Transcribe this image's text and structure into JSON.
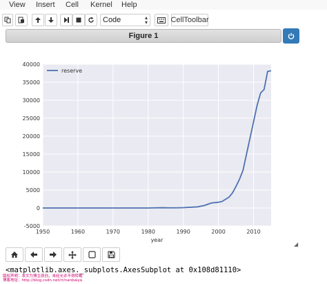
{
  "menu": [
    "View",
    "Insert",
    "Cell",
    "Kernel",
    "Help"
  ],
  "toolbar": {
    "cell_type": "Code",
    "cell_toolbar_label": "CellToolbar"
  },
  "figure": {
    "title": "Figure 1"
  },
  "chart_data": {
    "type": "line",
    "title": "",
    "xlabel": "year",
    "ylabel": "",
    "xlim": [
      1950,
      2015
    ],
    "ylim": [
      -5000,
      40000
    ],
    "x_ticks": [
      1950,
      1960,
      1970,
      1980,
      1990,
      2000,
      2010
    ],
    "y_ticks": [
      -5000,
      0,
      5000,
      10000,
      15000,
      20000,
      25000,
      30000,
      35000,
      40000
    ],
    "grid": true,
    "legend_position": "top-left",
    "series": [
      {
        "name": "reserve",
        "color": "#4c72b0",
        "x": [
          1950,
          1960,
          1970,
          1980,
          1982,
          1984,
          1986,
          1988,
          1990,
          1992,
          1994,
          1996,
          1998,
          2000,
          2001,
          2002,
          2003,
          2004,
          2005,
          2006,
          2007,
          2008,
          2009,
          2010,
          2011,
          2012,
          2013,
          2014,
          2015
        ],
        "y": [
          0,
          0,
          0,
          0,
          50,
          80,
          50,
          50,
          100,
          200,
          300,
          700,
          1400,
          1600,
          1800,
          2400,
          3000,
          4200,
          6000,
          8000,
          10500,
          15000,
          19500,
          24000,
          28500,
          32000,
          33000,
          38000,
          38200
        ]
      }
    ]
  },
  "output": {
    "text": "<matplotlib.axes._subplots.AxesSubplot at 0x108d81110>"
  },
  "watermark": {
    "line1": "版权声明：本文为博主原创，未经允许不得转载",
    "line2": "博客地址：http://blog.csdn.net/rr/nanbaiya"
  },
  "colors": {
    "plot_background": "#eaeaf2",
    "grid": "#ffffff",
    "line": "#4c72b0",
    "accent": "#337ab7"
  }
}
